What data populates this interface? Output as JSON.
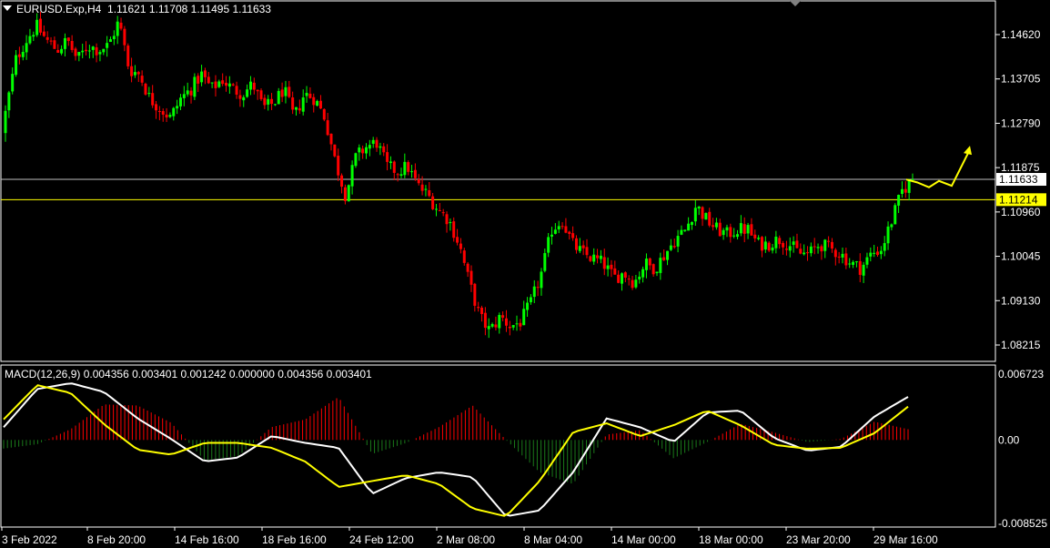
{
  "header": {
    "symbol": "EURUSD.Exp,H4",
    "ohlc": "1.11621 1.11708 1.11495 1.11633"
  },
  "macd": {
    "label": "MACD(12,26,9) 0.004356 0.003401 0.001242 0.000000 0.004356 0.003401"
  },
  "colors": {
    "bull": "#00ff00",
    "bear": "#ff0000",
    "signal": "#ffff00",
    "macd_line": "#ffffff",
    "grid": "#ffffff",
    "price_level": "#c0c0c0",
    "hline": "#ffff00"
  },
  "chart_data": [
    {
      "type": "candlestick",
      "title": "EURUSD.Exp,H4",
      "y_ticks": [
        "1.14620",
        "1.13705",
        "1.12790",
        "1.11875",
        "1.10960",
        "1.10045",
        "1.09130",
        "1.08215"
      ],
      "ylim": [
        1.0785,
        1.1548
      ],
      "current_price": "1.11633",
      "horizontal_line": "1.11214",
      "x_ticks": [
        "3 Feb 2022",
        "8 Feb 20:00",
        "14 Feb 16:00",
        "18 Feb 16:00",
        "24 Feb 12:00",
        "2 Mar 08:00",
        "8 Mar 04:00",
        "14 Mar 00:00",
        "18 Mar 00:00",
        "23 Mar 20:00",
        "29 Mar 16:00"
      ],
      "close_path": [
        1.13,
        1.141,
        1.145,
        1.148,
        1.145,
        1.143,
        1.145,
        1.141,
        1.144,
        1.143,
        1.144,
        1.149,
        1.139,
        1.138,
        1.133,
        1.131,
        1.129,
        1.133,
        1.135,
        1.138,
        1.135,
        1.137,
        1.135,
        1.134,
        1.136,
        1.131,
        1.132,
        1.135,
        1.129,
        1.134,
        1.133,
        1.129,
        1.12,
        1.113,
        1.121,
        1.123,
        1.124,
        1.119,
        1.118,
        1.119,
        1.115,
        1.113,
        1.11,
        1.108,
        1.103,
        1.095,
        1.088,
        1.085,
        1.088,
        1.086,
        1.087,
        1.091,
        1.097,
        1.106,
        1.108,
        1.103,
        1.101,
        1.1,
        1.099,
        1.096,
        1.097,
        1.095,
        1.099,
        1.098,
        1.101,
        1.104,
        1.106,
        1.111,
        1.108,
        1.106,
        1.105,
        1.106,
        1.106,
        1.103,
        1.103,
        1.104,
        1.103,
        1.101,
        1.101,
        1.103,
        1.102,
        1.101,
        1.099,
        1.098,
        1.101,
        1.102,
        1.108,
        1.114,
        1.1163
      ],
      "forecast_arrows": [
        1.1163,
        1.1157,
        1.1147,
        1.116,
        1.115,
        1.118
      ],
      "annotations": []
    },
    {
      "type": "macd",
      "title": "MACD(12,26,9)",
      "params": [
        12,
        26,
        9
      ],
      "values_printed": [
        0.004356,
        0.003401,
        0.001242,
        0.0,
        0.004356,
        0.003401
      ],
      "y_ticks": [
        "0.006723",
        "0.00",
        "-0.008525"
      ],
      "ylim": [
        -0.008525,
        0.006723
      ],
      "macd_line": [
        0.0013,
        0.0052,
        0.0058,
        0.0049,
        0.0022,
        0.0001,
        -0.0022,
        -0.0018,
        0.0004,
        -0.0003,
        -0.0008,
        -0.0055,
        -0.0039,
        -0.0033,
        -0.0038,
        -0.0078,
        -0.0072,
        -0.0033,
        0.0022,
        0.0013,
        -0.0002,
        0.0028,
        0.003,
        0.0002,
        -0.0011,
        -0.0007,
        0.0024,
        0.0044
      ],
      "signal_line": [
        0.0021,
        0.0056,
        0.0048,
        0.0016,
        -0.001,
        -0.0015,
        -0.0003,
        -0.0003,
        -0.0008,
        -0.0022,
        -0.0048,
        -0.0042,
        -0.0036,
        -0.0045,
        -0.007,
        -0.0078,
        -0.0042,
        0.0008,
        0.0017,
        0.0004,
        0.0015,
        0.003,
        0.0015,
        -0.0005,
        -0.0009,
        -0.0008,
        0.0007,
        0.0034
      ],
      "histogram_note": "red above zero, green below zero"
    }
  ]
}
